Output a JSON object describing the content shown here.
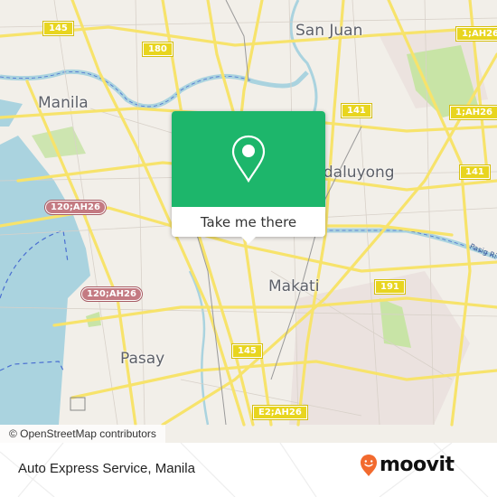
{
  "map": {
    "places": [
      {
        "id": "manila",
        "label": "Manila"
      },
      {
        "id": "san-juan",
        "label": "San Juan"
      },
      {
        "id": "mandaluyong",
        "label": "Mandaluyong"
      },
      {
        "id": "makati",
        "label": "Makati"
      },
      {
        "id": "pasay",
        "label": "Pasay"
      }
    ],
    "shields": [
      {
        "label": "145"
      },
      {
        "label": "180"
      },
      {
        "label": "1;AH26"
      },
      {
        "label": "141"
      },
      {
        "label": "1;AH26"
      },
      {
        "label": "141"
      },
      {
        "label": "120;AH26"
      },
      {
        "label": "120;AH26"
      },
      {
        "label": "191"
      },
      {
        "label": "145"
      },
      {
        "label": "E2;AH26"
      }
    ],
    "river_label": "Pasig River",
    "attribution": "© OpenStreetMap contributors",
    "colors": {
      "water": "#aad3df",
      "land": "#f2efe9",
      "road": "#f7e36b",
      "park": "#c8e4a6",
      "accent": "#1db66b"
    }
  },
  "popup": {
    "icon": "map-pin-icon",
    "button_label": "Take me there"
  },
  "footer": {
    "place_title": "Auto Express Service, Manila",
    "logo_text": "moovit",
    "logo_icon": "moovit-smile-pin-icon"
  }
}
